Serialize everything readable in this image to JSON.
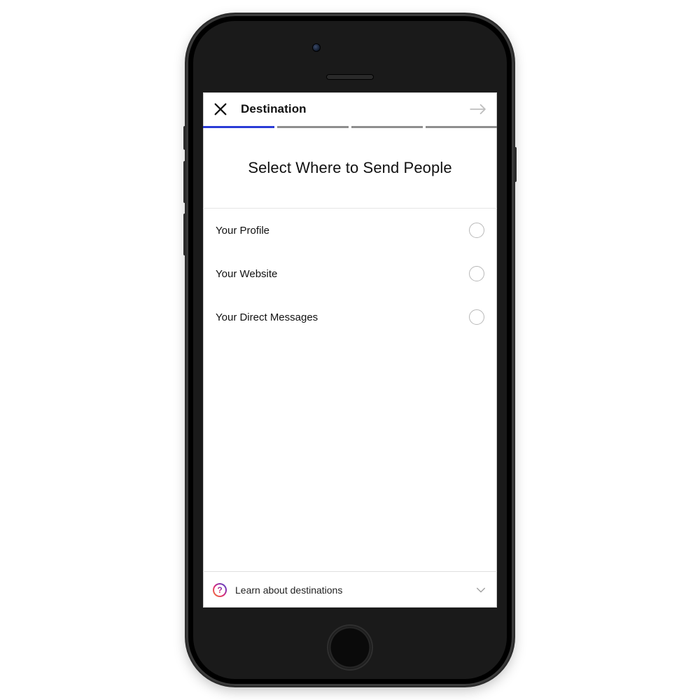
{
  "header": {
    "title": "Destination"
  },
  "progress": {
    "totalSteps": 4,
    "currentStep": 1
  },
  "main": {
    "heading": "Select Where to Send People",
    "options": [
      {
        "label": "Your Profile",
        "selected": false
      },
      {
        "label": "Your Website",
        "selected": false
      },
      {
        "label": "Your Direct Messages",
        "selected": false
      }
    ]
  },
  "footer": {
    "helpLabel": "Learn about destinations",
    "helpGlyph": "?"
  }
}
